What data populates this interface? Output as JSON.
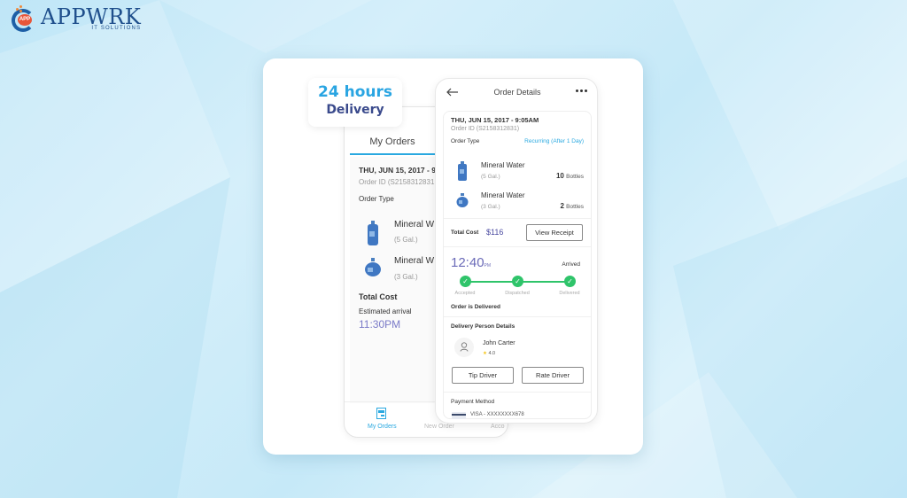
{
  "brand": {
    "name": "APPWRK",
    "tagline": "IT SOLUTIONS",
    "bubble": "APP",
    "colors": {
      "primary": "#1f4f8c",
      "accent": "#e8563a"
    }
  },
  "badge": {
    "line1": "24 hours",
    "line2": "Delivery",
    "colors": {
      "line1": "#2aa5e2",
      "line2": "#3a4a8c"
    }
  },
  "back_phone": {
    "tab_label": "My Orders",
    "date": "THU, JUN 15, 2017 - 9",
    "order_id": "Order ID (S2158312831",
    "order_type_label": "Order Type",
    "items": [
      {
        "name": "Mineral W",
        "size": "(5 Gal.)"
      },
      {
        "name": "Mineral W",
        "size": "(3 Gal.)"
      }
    ],
    "total_cost_label": "Total Cost",
    "arrival_label": "Estimated arrival",
    "arrival_time": "11:30PM",
    "nav": [
      {
        "label": "My Orders",
        "icon": "orders-icon",
        "active": true
      },
      {
        "label": "New Order",
        "icon": "new-order-icon",
        "active": false
      },
      {
        "label": "Acco",
        "icon": "account-icon",
        "active": false
      }
    ]
  },
  "front_phone": {
    "header_title": "Order Details",
    "back_icon": "arrow-left-icon",
    "more_icon": "more-dots-icon",
    "date": "THU, JUN 15, 2017 - 9:05AM",
    "order_id": "Order ID (S2158312831)",
    "order_type_label": "Order Type",
    "order_type_value": "Recurring (After 1 Day)",
    "items": [
      {
        "name": "Mineral Water",
        "size": "(5 Gal.)",
        "qty": "10",
        "unit": "Bottles"
      },
      {
        "name": "Mineral Water",
        "size": "(3 Gal.)",
        "qty": "2",
        "unit": "Bottles"
      }
    ],
    "total_cost_label": "Total Cost",
    "total_cost_value": "$116",
    "view_receipt_label": "View Receipt",
    "time": "12:40",
    "time_suffix": "PM",
    "status_label": "Arrived",
    "steps": [
      "Accepted",
      "Dispatched",
      "Delivered"
    ],
    "progress_completed_steps": 3,
    "delivered_text": "Order is Delivered",
    "delivery_person_heading": "Delivery Person Details",
    "driver_name": "John Carter",
    "driver_rating": "4.0",
    "tip_driver_label": "Tip Driver",
    "rate_driver_label": "Rate Driver",
    "payment_heading": "Payment Method",
    "payment_value": "VISA - XXXXXXXX678",
    "colors": {
      "accent": "#29a8e0",
      "success": "#2fc46a",
      "price": "#4a4aa0"
    }
  }
}
